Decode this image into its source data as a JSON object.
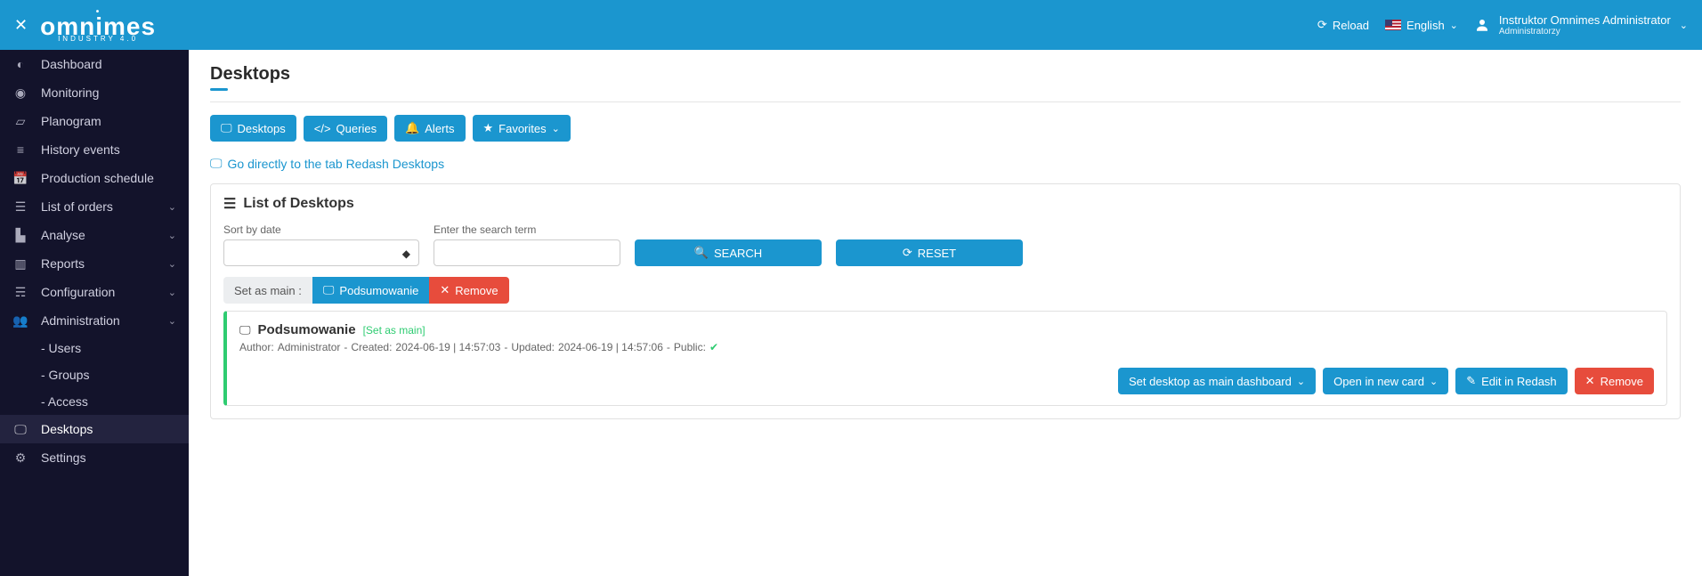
{
  "brand": {
    "name": "omnimes",
    "tagline": "INDUSTRY 4.0"
  },
  "header": {
    "reload": "Reload",
    "language": "English",
    "user_name": "Instruktor Omnimes Administrator",
    "user_role": "Administratorzy"
  },
  "sidebar": {
    "items": [
      {
        "icon": "gauge",
        "label": "Dashboard",
        "expandable": false
      },
      {
        "icon": "eye",
        "label": "Monitoring",
        "expandable": false
      },
      {
        "icon": "map",
        "label": "Planogram",
        "expandable": false
      },
      {
        "icon": "list",
        "label": "History events",
        "expandable": false
      },
      {
        "icon": "calendar",
        "label": "Production schedule",
        "expandable": false
      },
      {
        "icon": "list-check",
        "label": "List of orders",
        "expandable": true
      },
      {
        "icon": "chart",
        "label": "Analyse",
        "expandable": true
      },
      {
        "icon": "bar-chart",
        "label": "Reports",
        "expandable": true
      },
      {
        "icon": "sliders",
        "label": "Configuration",
        "expandable": true
      },
      {
        "icon": "users",
        "label": "Administration",
        "expandable": true,
        "open": true,
        "subs": [
          "- Users",
          "- Groups",
          "- Access"
        ]
      },
      {
        "icon": "desktop",
        "label": "Desktops",
        "expandable": false,
        "active": true
      },
      {
        "icon": "gears",
        "label": "Settings",
        "expandable": false
      }
    ]
  },
  "page": {
    "title": "Desktops",
    "tabs": {
      "desktops": "Desktops",
      "queries": "Queries",
      "alerts": "Alerts",
      "favorites": "Favorites"
    },
    "redash_link": "Go directly to the tab Redash Desktops",
    "panel_title": "List of Desktops",
    "sort_label": "Sort by date",
    "search_label": "Enter the search term",
    "search_btn": "SEARCH",
    "reset_btn": "RESET",
    "set_as_main_label": "Set as main :",
    "set_main_value": "Podsumowanie",
    "remove_btn": "Remove",
    "desktop_item": {
      "title": "Podsumowanie",
      "set_as_main_tag": "[Set as main]",
      "meta_author_label": "Author:",
      "meta_author": "Administrator",
      "meta_created_label": "Created:",
      "meta_created": "2024-06-19 | 14:57:03",
      "meta_updated_label": "Updated:",
      "meta_updated": "2024-06-19 | 14:57:06",
      "meta_public_label": "Public:",
      "actions": {
        "set_main_dashboard": "Set desktop as main dashboard",
        "open_new_card": "Open in new card",
        "edit_redash": "Edit in Redash",
        "remove": "Remove"
      }
    }
  }
}
